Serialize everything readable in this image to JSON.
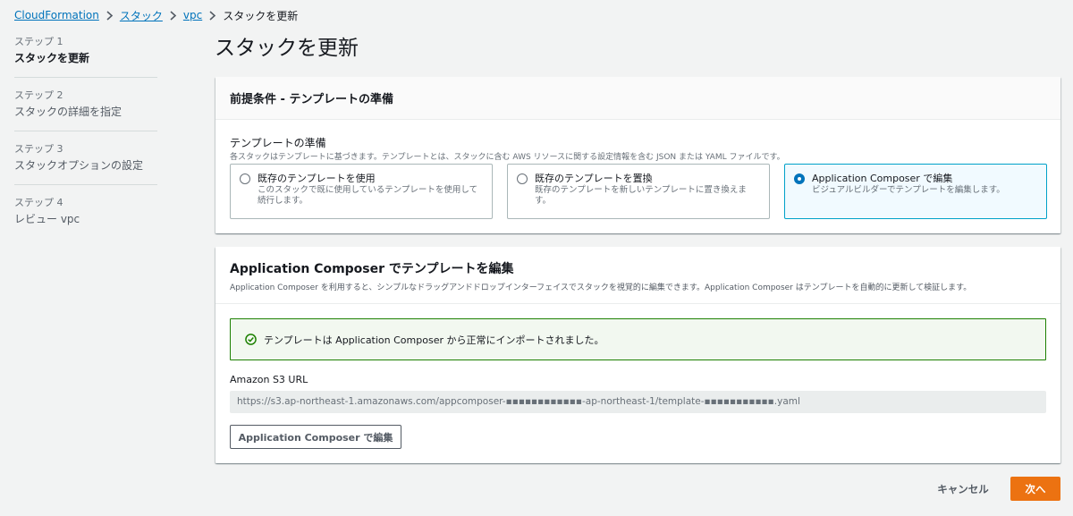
{
  "breadcrumb": {
    "items": [
      "CloudFormation",
      "スタック",
      "vpc"
    ],
    "current": "スタックを更新"
  },
  "steps": [
    {
      "num": "ステップ 1",
      "name": "スタックを更新"
    },
    {
      "num": "ステップ 2",
      "name": "スタックの詳細を指定"
    },
    {
      "num": "ステップ 3",
      "name": "スタックオプションの設定"
    },
    {
      "num": "ステップ 4",
      "name": "レビュー vpc"
    }
  ],
  "page_title": "スタックを更新",
  "prerequisite": {
    "header": "前提条件 - テンプレートの準備",
    "field_label": "テンプレートの準備",
    "field_desc": "各スタックはテンプレートに基づきます。テンプレートとは、スタックに含む AWS リソースに関する設定情報を含む JSON または YAML ファイルです。",
    "options": [
      {
        "title": "既存のテンプレートを使用",
        "desc": "このスタックで既に使用しているテンプレートを使用して続行します。",
        "selected": false
      },
      {
        "title": "既存のテンプレートを置換",
        "desc": "既存のテンプレートを新しいテンプレートに置き換えます。",
        "selected": false
      },
      {
        "title": "Application Composer で編集",
        "desc": "ビジュアルビルダーでテンプレートを編集します。",
        "selected": true
      }
    ]
  },
  "composer": {
    "title": "Application Composer でテンプレートを編集",
    "desc": "Application Composer を利用すると、シンプルなドラッグアンドドロップインターフェイスでスタックを視覚的に編集できます。Application Composer はテンプレートを自動的に更新して検証します。",
    "success_message": "テンプレートは Application Composer から正常にインポートされました。",
    "s3_label": "Amazon S3 URL",
    "s3_url": "https://s3.ap-northeast-1.amazonaws.com/appcomposer-▪▪▪▪▪▪▪▪▪▪▪▪-ap-northeast-1/template-▪▪▪▪▪▪▪▪▪▪▪.yaml",
    "edit_button": "Application Composer で編集"
  },
  "footer": {
    "cancel": "キャンセル",
    "next": "次へ"
  },
  "colors": {
    "link": "#0073bb",
    "primary_button": "#ec7211",
    "success_border": "#1d8102",
    "selected_border": "#00a1c9"
  }
}
